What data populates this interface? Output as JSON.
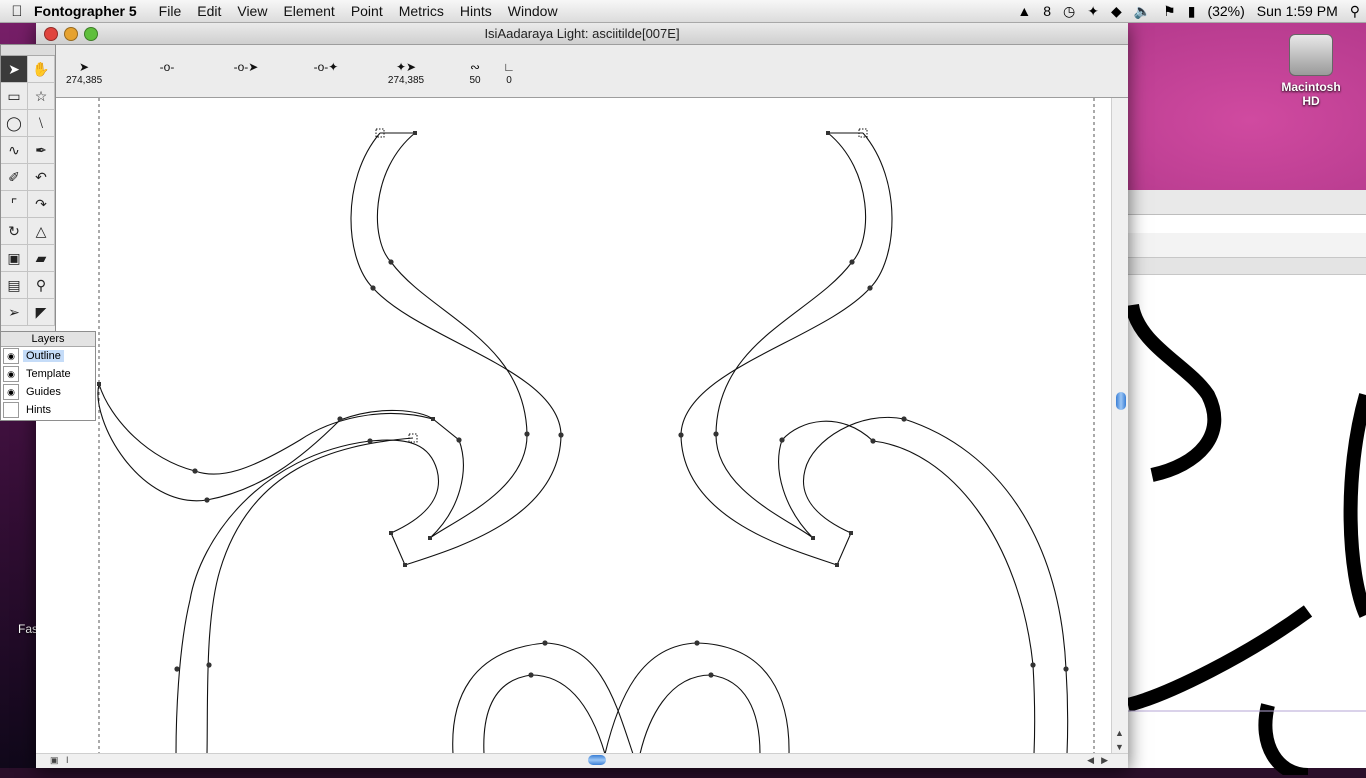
{
  "menubar": {
    "app_name": "Fontographer 5",
    "items": [
      "File",
      "Edit",
      "View",
      "Element",
      "Point",
      "Metrics",
      "Hints",
      "Window"
    ],
    "status": {
      "adobe": "8",
      "battery": "(32%)",
      "clock": "Sun 1:59 PM"
    }
  },
  "desktop": {
    "hd_label": "Macintosh HD",
    "side_clip": "Fas"
  },
  "window": {
    "title": "IsiAadaraya Light: asciitilde[007E]",
    "toolbar": {
      "pointer_coords": "274,385",
      "point_coords": "274,385",
      "tension": "50",
      "value": "0"
    }
  },
  "layers": {
    "title": "Layers",
    "items": [
      {
        "label": "Outline",
        "visible": true,
        "selected": true
      },
      {
        "label": "Template",
        "visible": true
      },
      {
        "label": "Guides",
        "visible": true
      },
      {
        "label": "Hints",
        "visible": false
      }
    ]
  }
}
